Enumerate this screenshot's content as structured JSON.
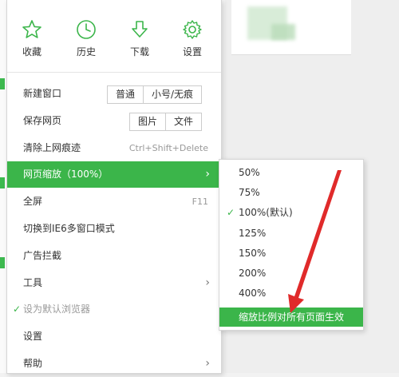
{
  "quick_actions": [
    {
      "label": "收藏",
      "icon": "star-icon"
    },
    {
      "label": "历史",
      "icon": "clock-icon"
    },
    {
      "label": "下载",
      "icon": "download-icon"
    },
    {
      "label": "设置",
      "icon": "gear-icon"
    }
  ],
  "menu": {
    "new_window": {
      "label": "新建窗口",
      "buttons": [
        "普通",
        "小号/无痕"
      ]
    },
    "save_page": {
      "label": "保存网页",
      "buttons": [
        "图片",
        "文件"
      ]
    },
    "clear_traces": {
      "label": "清除上网痕迹",
      "shortcut": "Ctrl+Shift+Delete"
    },
    "zoom": {
      "label": "网页缩放（100%）"
    },
    "fullscreen": {
      "label": "全屏",
      "shortcut": "F11"
    },
    "ie6_mode": {
      "label": "切换到IE6多窗口模式"
    },
    "adblock": {
      "label": "广告拦截"
    },
    "tools": {
      "label": "工具"
    },
    "default_browser": {
      "label": "设为默认浏览器"
    },
    "settings": {
      "label": "设置"
    },
    "help": {
      "label": "帮助"
    }
  },
  "zoom_submenu": {
    "options": [
      "50%",
      "75%",
      "100%(默认)",
      "125%",
      "150%",
      "200%",
      "400%"
    ],
    "selected": "100%(默认)",
    "footer": "缩放比例对所有页面生效"
  },
  "colors": {
    "accent": "#3bb54a",
    "arrow": "#e02a2a"
  }
}
